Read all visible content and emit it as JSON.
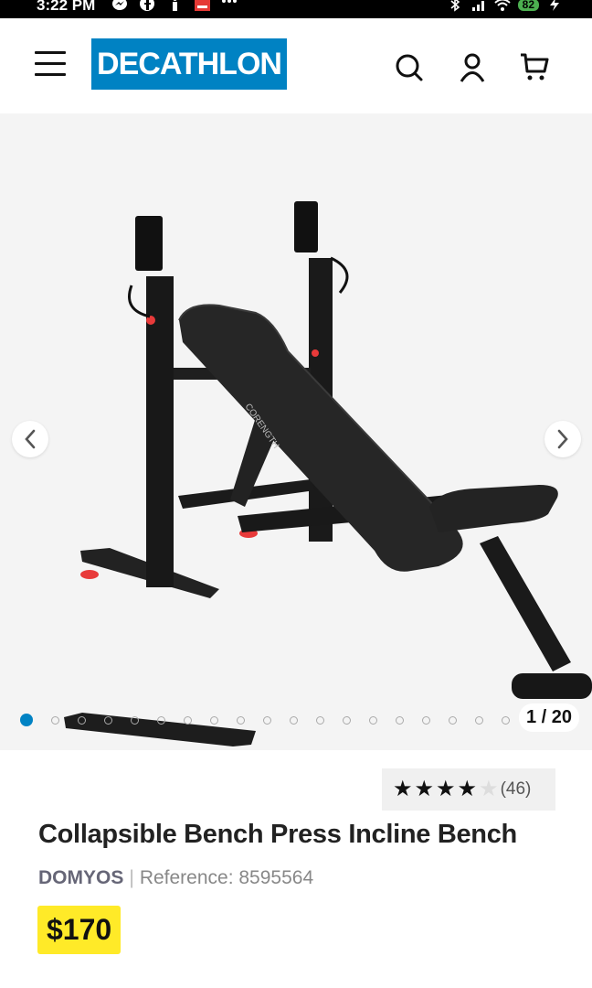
{
  "status_bar": {
    "time": "3:22 PM",
    "battery": "82"
  },
  "header": {
    "logo": "DECATHLON",
    "icons": [
      "menu-icon",
      "search-icon",
      "account-icon",
      "cart-icon"
    ]
  },
  "gallery": {
    "counter": "1 / 20",
    "total_images": 20,
    "active_index": 1,
    "image_text": "CORENGTH"
  },
  "product": {
    "rating_value": 4,
    "rating_count": "(46)",
    "title": "Collapsible Bench Press Incline Bench",
    "brand": "DOMYOS",
    "separator": "|",
    "reference": "Reference: 8595564",
    "price": "$170"
  },
  "colors": {
    "brand_blue": "#0082c3",
    "price_yellow": "#ffea28"
  }
}
